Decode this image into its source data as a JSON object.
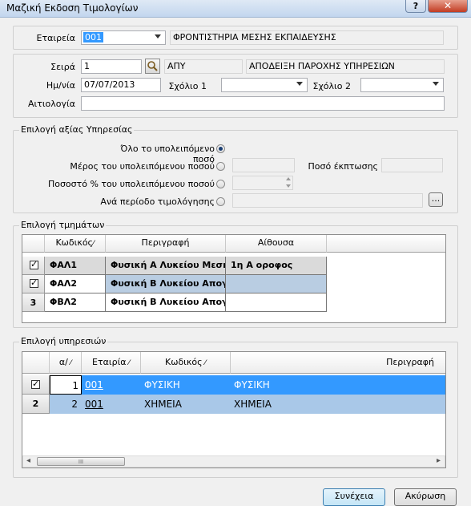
{
  "window": {
    "title": "Μαζική Εκδοση Τιμολογίων",
    "help": "?",
    "close": "✕"
  },
  "header": {
    "company_label": "Εταιρεία",
    "company_code": "001",
    "company_name": "ΦΡΟΝΤΙΣΤΗΡΙΑ ΜΕΣΗΣ ΕΚΠΑΙΔΕΥΣΗΣ",
    "series_label": "Σειρά",
    "series_value": "1",
    "series_code": "ΑΠΥ",
    "series_name": "ΑΠΟΔΕΙΞΗ ΠΑΡΟΧΗΣ ΥΠΗΡΕΣΙΩΝ",
    "date_label": "Ημ/νία",
    "date_value": "07/07/2013",
    "comment1_label": "Σχόλιο 1",
    "comment2_label": "Σχόλιο 2",
    "reason_label": "Αιτιολογία"
  },
  "service_value": {
    "legend": "Επιλογή αξίας Υπηρεσίας",
    "opt_all": "Όλο το υπολειπόμενο ποσό",
    "opt_part": "Μέρος του υπολειπόμενου ποσού",
    "opt_percent": "Ποσοστό % του υπολειπόμενου ποσού",
    "opt_period": "Ανά περίοδο τιμολόγησης",
    "discount_label": "Ποσό έκπτωσης",
    "browse": "..."
  },
  "sections": {
    "legend": "Επιλογή τμημάτων",
    "columns": [
      "Κωδικός",
      "Περιγραφή",
      "Αίθουσα"
    ],
    "rows": [
      {
        "indicator": "",
        "code": "ΦΑΛ1",
        "desc": "Φυσική Α Λυκείου Μεσημ...",
        "room": "1η Α οροφος",
        "checked": true
      },
      {
        "indicator": "",
        "code": "ΦΑΛ2",
        "desc": "Φυσική Β Λυκείου Απογε...",
        "room": "",
        "checked": true
      },
      {
        "indicator": "3",
        "code": "ΦΒΛ2",
        "desc": "Φυσική Β Λυκείου Απογε...",
        "room": "",
        "checked": false
      }
    ]
  },
  "services": {
    "legend": "Επιλογή υπηρεσιών",
    "columns": [
      "α/",
      "Εταιρία",
      "Κωδικός",
      "Περιγραφή"
    ],
    "rows": [
      {
        "indicator": "",
        "num": "1",
        "company": "001",
        "code": "ΦΥΣΙΚΗ",
        "desc": "ΦΥΣΙΚΗ",
        "checked": true
      },
      {
        "indicator": "2",
        "num": "2",
        "company": "001",
        "code": "ΧΗΜΕΙΑ",
        "desc": "ΧΗΜΕΙΑ",
        "checked": false
      }
    ],
    "scroll_left": "◂",
    "scroll_right": "▸",
    "scroll_grip": "III"
  },
  "buttons": {
    "continue": "Συνέχεια",
    "cancel": "Ακύρωση"
  },
  "colors": {
    "selected_row": "#3399ff",
    "alt_row": "#a9c8e8",
    "title_bar": "#c2d6ee"
  }
}
